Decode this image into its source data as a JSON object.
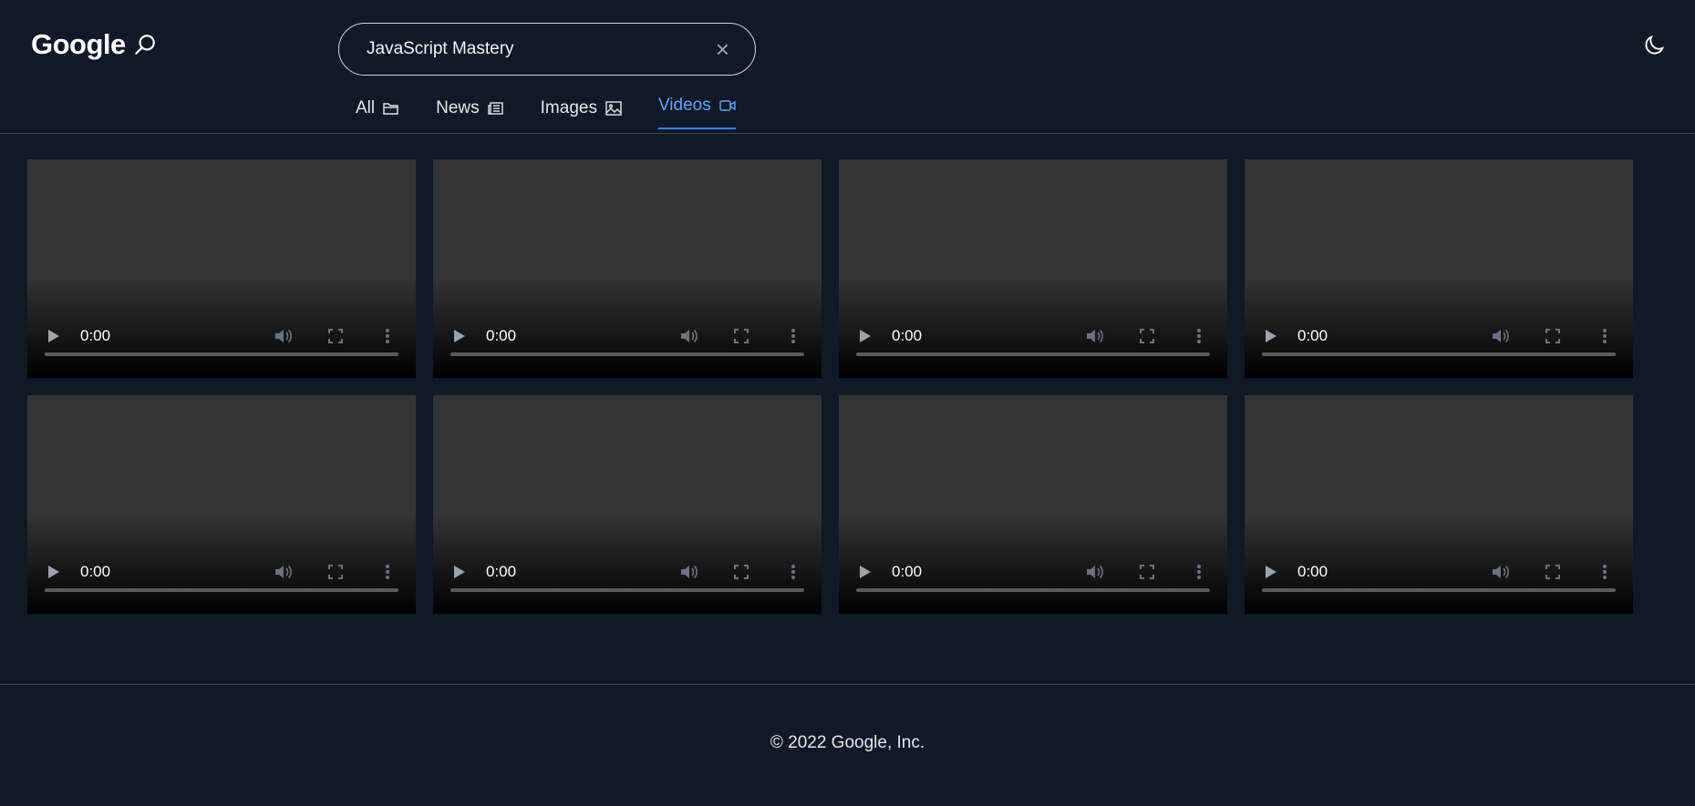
{
  "header": {
    "logo_text": "Google",
    "search_value": "JavaScript Mastery",
    "clear_label": "×"
  },
  "icons": {
    "logo": "search-icon",
    "clear": "close-icon",
    "theme": "moon-icon"
  },
  "tabs": [
    {
      "label": "All",
      "icon": "folder-icon",
      "active": false
    },
    {
      "label": "News",
      "icon": "newspaper-icon",
      "active": false
    },
    {
      "label": "Images",
      "icon": "image-icon",
      "active": false
    },
    {
      "label": "Videos",
      "icon": "video-camera-icon",
      "active": true
    }
  ],
  "videos": [
    {
      "time": "0:00"
    },
    {
      "time": "0:00"
    },
    {
      "time": "0:00"
    },
    {
      "time": "0:00"
    },
    {
      "time": "0:00"
    },
    {
      "time": "0:00"
    },
    {
      "time": "0:00"
    },
    {
      "time": "0:00"
    }
  ],
  "footer": {
    "copyright": "© 2022 Google, Inc."
  },
  "colors": {
    "background": "#111827",
    "accent": "#60a5fa",
    "border": "#374151"
  }
}
